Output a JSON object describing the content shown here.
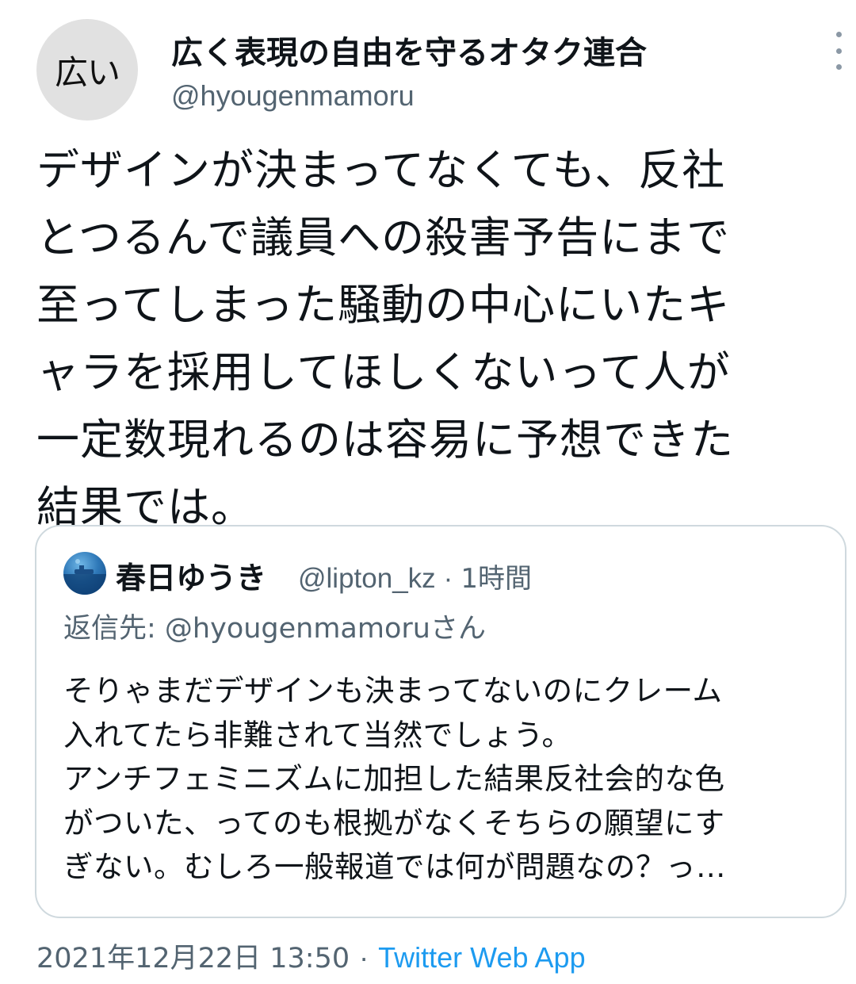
{
  "author": {
    "avatar_text": "広い",
    "display_name": "広く表現の自由を守るオタク連合",
    "handle": "@hyougenmamoru"
  },
  "more_icon": "more-vertical-icon",
  "tweet": {
    "text_lines": [
      "デザインが決まってなくても、反社",
      "とつるんで議員への殺害予告にまで",
      "至ってしまった騒動の中心にいたキ",
      "ャラを採用してほしくないって人が",
      "一定数現れるのは容易に予想できた",
      "結果では。"
    ]
  },
  "quote": {
    "avatar_icon": "ocean-avatar-icon",
    "display_name": "春日ゆうき",
    "handle": "@lipton_kz",
    "separator": "·",
    "time": "1時間",
    "reply_to": "返信先: @hyougenmamoruさん",
    "text_lines": [
      "そりゃまだデザインも決まってないのにクレーム",
      "入れてたら非難されて当然でしょう。",
      "アンチフェミニズムに加担した結果反社会的な色",
      "がついた、ってのも根拠がなくそちらの願望にす",
      "ぎない。むしろ一般報道では何が問題なの？っ…"
    ]
  },
  "footer": {
    "datetime": "2021年12月22日 13:50",
    "separator": "·",
    "source": "Twitter Web App"
  },
  "colors": {
    "text": "#0f1419",
    "secondary": "#536471",
    "link": "#1d9bf0",
    "border": "#cfd9de"
  }
}
